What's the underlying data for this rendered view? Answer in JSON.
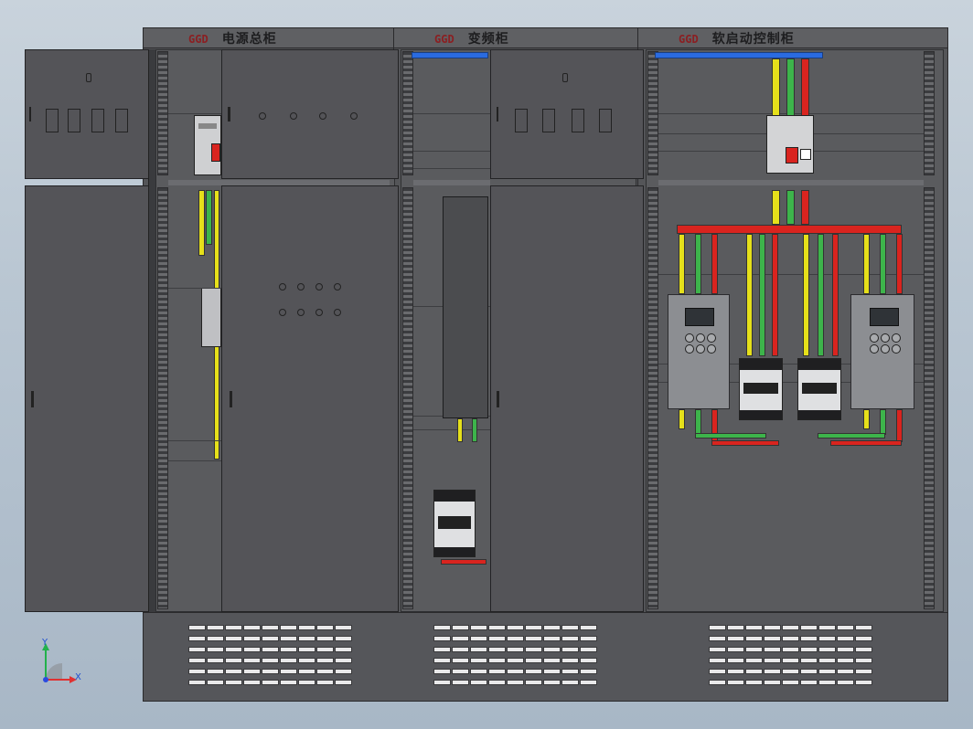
{
  "cabinets": [
    {
      "prefix": "GGD",
      "name": "电源总柜"
    },
    {
      "prefix": "GGD",
      "name": "变频柜"
    },
    {
      "prefix": "GGD",
      "name": "软启动控制柜"
    }
  ],
  "axis": {
    "y_label": "Y",
    "x_label": "X"
  },
  "colors": {
    "background": "#b9c6d2",
    "cabinet": "#545558",
    "busbar_yellow": "#e6e01a",
    "busbar_green": "#3db44b",
    "busbar_red": "#d9241f",
    "busbar_blue": "#2a6be0"
  }
}
